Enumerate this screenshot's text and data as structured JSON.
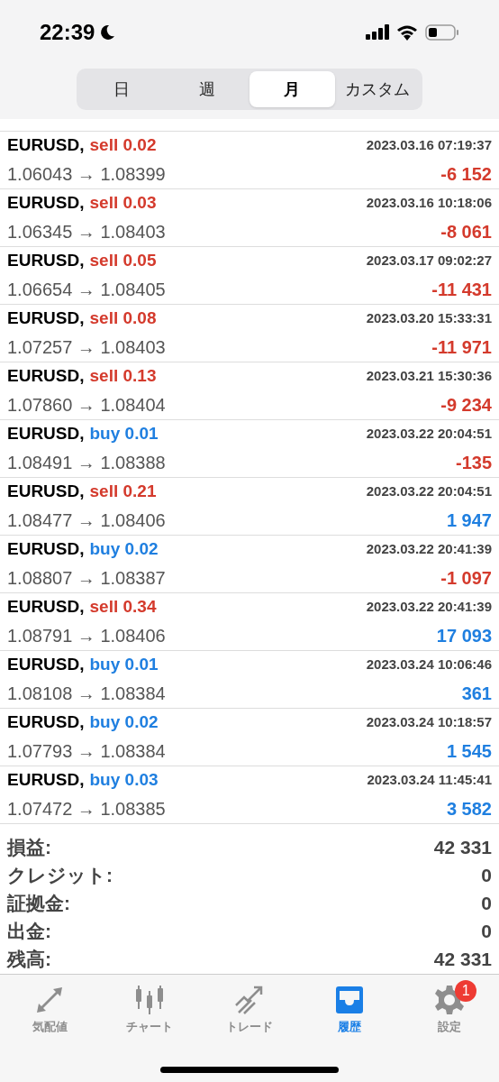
{
  "status_bar": {
    "time": "22:39"
  },
  "tabs": [
    {
      "label": "日",
      "selected": false
    },
    {
      "label": "週",
      "selected": false
    },
    {
      "label": "月",
      "selected": true
    },
    {
      "label": "カスタム",
      "selected": false
    }
  ],
  "deals": [
    {
      "symbol": "EURUSD,",
      "side": "sell",
      "volume": "0.02",
      "time": "2023.03.16 07:19:37",
      "prices": "1.06043 → 1.08399",
      "profit": "-6 152",
      "loss": true
    },
    {
      "symbol": "EURUSD,",
      "side": "sell",
      "volume": "0.03",
      "time": "2023.03.16 10:18:06",
      "prices": "1.06345 → 1.08403",
      "profit": "-8 061",
      "loss": true
    },
    {
      "symbol": "EURUSD,",
      "side": "sell",
      "volume": "0.05",
      "time": "2023.03.17 09:02:27",
      "prices": "1.06654 → 1.08405",
      "profit": "-11 431",
      "loss": true
    },
    {
      "symbol": "EURUSD,",
      "side": "sell",
      "volume": "0.08",
      "time": "2023.03.20 15:33:31",
      "prices": "1.07257 → 1.08403",
      "profit": "-11 971",
      "loss": true
    },
    {
      "symbol": "EURUSD,",
      "side": "sell",
      "volume": "0.13",
      "time": "2023.03.21 15:30:36",
      "prices": "1.07860 → 1.08404",
      "profit": "-9 234",
      "loss": true
    },
    {
      "symbol": "EURUSD,",
      "side": "buy",
      "volume": "0.01",
      "time": "2023.03.22 20:04:51",
      "prices": "1.08491 → 1.08388",
      "profit": "-135",
      "loss": true
    },
    {
      "symbol": "EURUSD,",
      "side": "sell",
      "volume": "0.21",
      "time": "2023.03.22 20:04:51",
      "prices": "1.08477 → 1.08406",
      "profit": "1 947",
      "loss": false
    },
    {
      "symbol": "EURUSD,",
      "side": "buy",
      "volume": "0.02",
      "time": "2023.03.22 20:41:39",
      "prices": "1.08807 → 1.08387",
      "profit": "-1 097",
      "loss": true
    },
    {
      "symbol": "EURUSD,",
      "side": "sell",
      "volume": "0.34",
      "time": "2023.03.22 20:41:39",
      "prices": "1.08791 → 1.08406",
      "profit": "17 093",
      "loss": false
    },
    {
      "symbol": "EURUSD,",
      "side": "buy",
      "volume": "0.01",
      "time": "2023.03.24 10:06:46",
      "prices": "1.08108 → 1.08384",
      "profit": "361",
      "loss": false
    },
    {
      "symbol": "EURUSD,",
      "side": "buy",
      "volume": "0.02",
      "time": "2023.03.24 10:18:57",
      "prices": "1.07793 → 1.08384",
      "profit": "1 545",
      "loss": false
    },
    {
      "symbol": "EURUSD,",
      "side": "buy",
      "volume": "0.03",
      "time": "2023.03.24 11:45:41",
      "prices": "1.07472 → 1.08385",
      "profit": "3 582",
      "loss": false
    }
  ],
  "summary": [
    {
      "label": "損益:",
      "value": "42 331"
    },
    {
      "label": "クレジット:",
      "value": "0"
    },
    {
      "label": "証拠金:",
      "value": "0"
    },
    {
      "label": "出金:",
      "value": "0"
    },
    {
      "label": "残高:",
      "value": "42 331"
    }
  ],
  "tab_bar": [
    {
      "kind": "quotes",
      "label": "気配値",
      "selected": false
    },
    {
      "kind": "chart",
      "label": "チャート",
      "selected": false
    },
    {
      "kind": "trade",
      "label": "トレード",
      "selected": false
    },
    {
      "kind": "history",
      "label": "履歴",
      "selected": true
    },
    {
      "kind": "settings",
      "label": "設定",
      "selected": false,
      "badge": "1"
    }
  ]
}
